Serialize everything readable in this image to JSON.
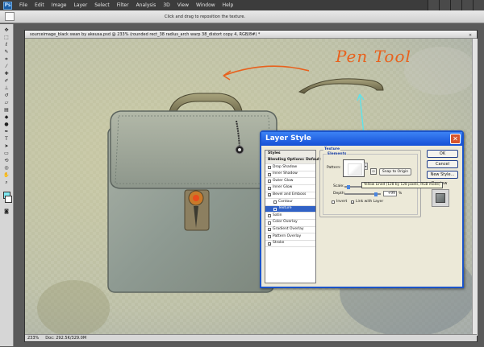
{
  "menubar": {
    "logo": "Ps",
    "items": [
      "File",
      "Edit",
      "Image",
      "Layer",
      "Select",
      "Filter",
      "Analysis",
      "3D",
      "View",
      "Window",
      "Help"
    ]
  },
  "options": {
    "hint": "Click and drag to reposition the texture."
  },
  "document": {
    "title": "sourceimage_black swan by akeusa.psd @ 233% (rounded rect_38 radius_arch warp 38_distort copy 4, RGB/8#) *",
    "close": "×",
    "zoom": "233%",
    "doc_size": "Doc: 292.5K/329.0M"
  },
  "annotation": {
    "pen_tool": "Pen Tool"
  },
  "dialog": {
    "title": "Layer Style",
    "close": "✕",
    "styles": [
      {
        "label": "Styles",
        "kind": "head",
        "checked": false
      },
      {
        "label": "Blending Options: Default",
        "kind": "head",
        "checked": false
      },
      {
        "label": "Drop Shadow",
        "kind": "item",
        "checked": false
      },
      {
        "label": "Inner Shadow",
        "kind": "item",
        "checked": false
      },
      {
        "label": "Outer Glow",
        "kind": "item",
        "checked": false
      },
      {
        "label": "Inner Glow",
        "kind": "item",
        "checked": false
      },
      {
        "label": "Bevel and Emboss",
        "kind": "item",
        "checked": true
      },
      {
        "label": "Contour",
        "kind": "sub",
        "checked": false
      },
      {
        "label": "Texture",
        "kind": "sub-selected",
        "checked": true
      },
      {
        "label": "Satin",
        "kind": "item",
        "checked": false
      },
      {
        "label": "Color Overlay",
        "kind": "item",
        "checked": false
      },
      {
        "label": "Gradient Overlay",
        "kind": "item",
        "checked": true
      },
      {
        "label": "Pattern Overlay",
        "kind": "item",
        "checked": false
      },
      {
        "label": "Stroke",
        "kind": "item",
        "checked": true
      }
    ],
    "texture": {
      "group_title": "Texture",
      "elements_title": "Elements",
      "pattern_label": "Pattern:",
      "snap_button": "Snap to Origin",
      "tooltip": "Yellow Lined (128 by 128 pixels, RGB mode)",
      "scale_label": "Scale:",
      "depth_label": "Depth:",
      "depth_value": "+99",
      "depth_unit": "%",
      "invert_label": "Invert",
      "link_label": "Link with Layer",
      "invert_checked": false,
      "link_checked": true
    },
    "buttons": {
      "ok": "OK",
      "cancel": "Cancel",
      "new_style": "New Style...",
      "preview": "Preview",
      "preview_checked": true
    }
  },
  "colors": {
    "foreground": "#7fe7f0",
    "background": "#ffffff",
    "annotation_orange": "#e8611d",
    "annotation_cyan": "#5fe3ea",
    "dialog_title_blue": "#1550d6"
  }
}
